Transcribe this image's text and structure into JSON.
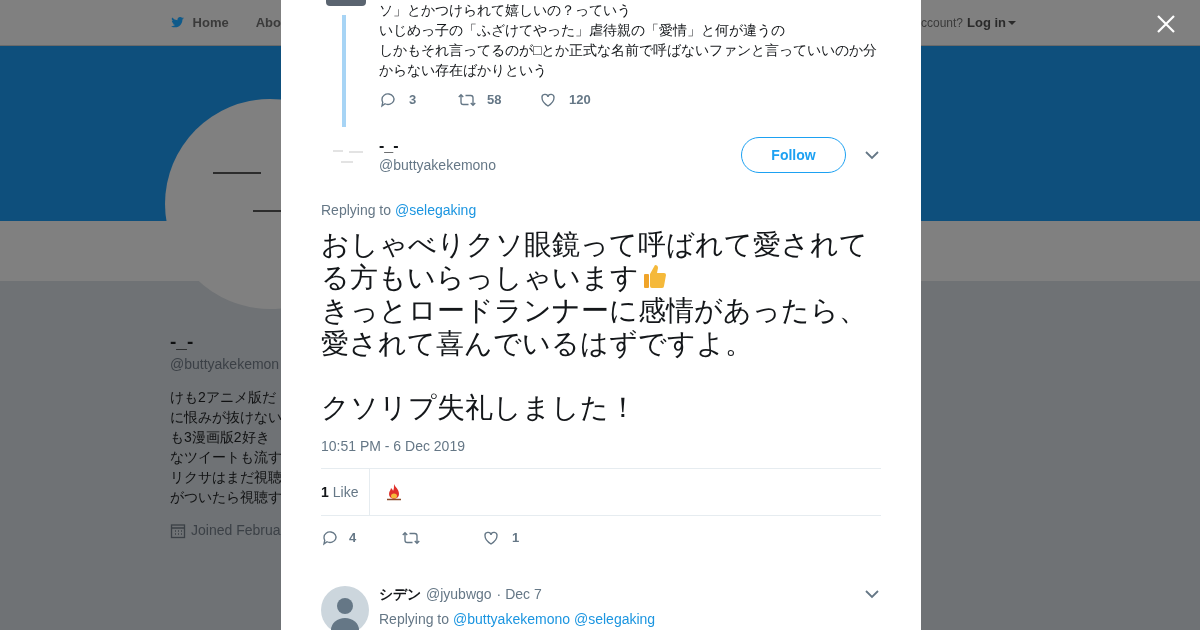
{
  "background": {
    "nav": {
      "items": [
        {
          "label": "Home"
        },
        {
          "label": "Abo"
        }
      ],
      "account_prompt": "ccount?",
      "login": "Log in"
    },
    "profile": {
      "name": "-_-",
      "handle": "@buttyakekemon",
      "bio_lines": [
        "けも2アニメ版だ",
        "に恨みが抜けない",
        "も3漫画版2好き",
        "なツイートも流す",
        "リクサはまだ視聴",
        "がついたら視聴す"
      ],
      "joined": "Joined Februa"
    }
  },
  "modal": {
    "previous_tweet": {
      "text_lines": [
        "ソ」とかつけられて嬉しいの？っていう",
        "いじめっ子の「ふざけてやった」虐待親の「愛情」と何が違うの",
        "しかもそれ言ってるのが□とか正式な名前で呼ばないファンと言っていいのか分",
        "からない存在ばかりという"
      ],
      "actions": {
        "replies": "3",
        "retweets": "58",
        "likes": "120"
      }
    },
    "tweet": {
      "name": "-_-",
      "handle": "@buttyakekemono",
      "follow": "Follow",
      "replying_prefix": "Replying to",
      "replying_to": [
        "@selegaking"
      ],
      "paragraphs": [
        "おしゃべりクソ眼鏡って呼ばれて愛されてる方もいらっしゃいます",
        "きっとロードランナーに感情があったら、愛されて喜んでいるはずですよ。",
        "クソリプ失礼しました！"
      ],
      "timestamp": "10:51 PM - 6 Dec 2019",
      "like_count": "1",
      "like_label": "Like",
      "actions": {
        "replies": "4",
        "likes": "1"
      }
    },
    "replies": [
      {
        "name": "シデン",
        "handle": "@jyubwgo",
        "date": "· Dec 7",
        "replying_prefix": "Replying to",
        "replying_to": [
          "@buttyakekemono",
          "@selegaking"
        ]
      }
    ]
  }
}
